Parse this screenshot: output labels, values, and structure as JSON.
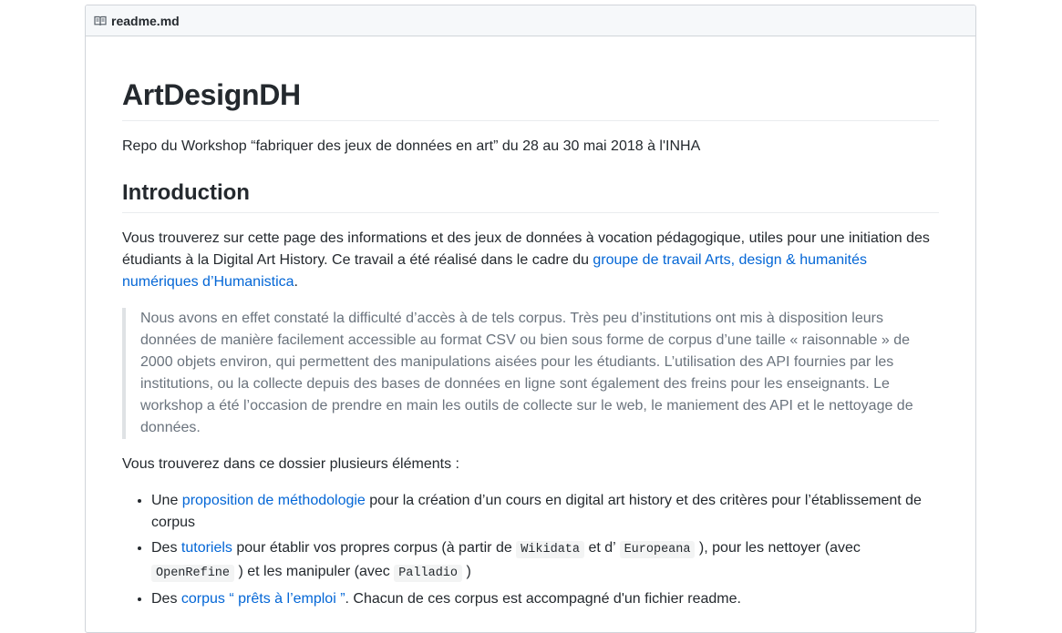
{
  "file": {
    "name": "readme.md",
    "icon": "book-icon"
  },
  "readme": {
    "title": "ArtDesignDH",
    "subtitle": "Repo du Workshop “fabriquer des jeux de données en art” du 28 au 30 mai 2018 à l'INHA",
    "intro_heading": "Introduction",
    "intro_p_text": "Vous trouverez sur cette page des informations et des jeux de données à vocation pédagogique, utiles pour une initiation des étudiants à la Digital Art History. Ce travail a été réalisé dans le cadre du ",
    "intro_p_link": "groupe de travail Arts, design & humanités numériques d’Humanistica",
    "intro_p_end": ".",
    "quote": "Nous avons en effet constaté la difficulté d’accès à de tels corpus. Très peu d’institutions ont mis à disposition leurs données de manière facilement accessible au format CSV ou bien sous forme de corpus d’une taille « raisonnable » de 2000 objets environ, qui permettent des manipulations aisées pour les étudiants. L’utilisation des API fournies par les institutions, ou la collecte depuis des bases de données en ligne sont également des freins pour les enseignants. Le workshop a été l’occasion de prendre en main les outils de collecte sur le web, le maniement des API et le nettoyage de données.",
    "list_intro": "Vous trouverez dans ce dossier plusieurs éléments :",
    "list": [
      {
        "pre": "Une ",
        "link": "proposition de méthodologie",
        "post": " pour la création d’un cours en digital art history et des critères pour l’établissement de corpus"
      },
      {
        "pre": "Des ",
        "link": "tutoriels",
        "mid1": " pour établir vos propres corpus (à partir de ",
        "code1": "Wikidata",
        "mid2": " et d’ ",
        "code2": "Europeana",
        "mid3": " ), pour les nettoyer (avec ",
        "code3": "OpenRefine",
        "mid4": " ) et les manipuler (avec ",
        "code4": "Palladio",
        "post": " )"
      },
      {
        "pre": "Des ",
        "link": "corpus “ prêts à l’emploi ”",
        "post": ". Chacun de ces corpus est accompagné d'un fichier readme."
      }
    ]
  }
}
